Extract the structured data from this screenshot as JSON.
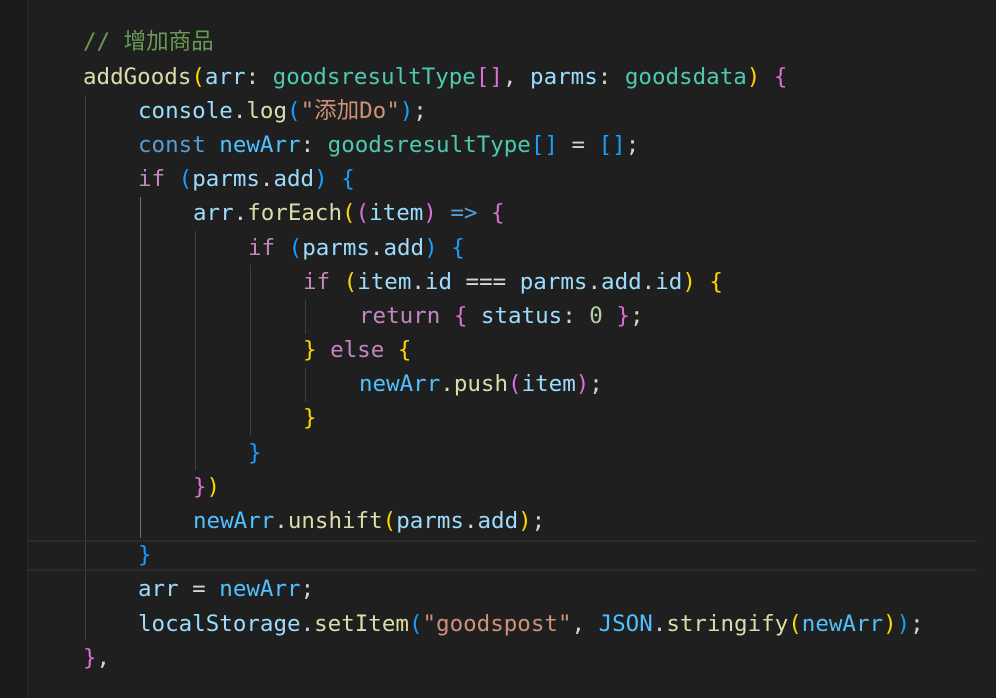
{
  "editor": {
    "theme": "dark",
    "colors": {
      "background": "#1f1f1f",
      "control_keyword": "#c586c0",
      "keyword": "#569cd6",
      "function": "#dcdcaa",
      "variable": "#9cdcfe",
      "constant": "#4fc1ff",
      "type": "#4ec9b0",
      "string": "#ce9178",
      "number": "#b5cea8",
      "comment": "#6a9955",
      "bracket_level1": "#ffd700",
      "bracket_level2": "#da70d6",
      "bracket_level3": "#179fff"
    },
    "code_lines": [
      "// 增加商品",
      "addGoods(arr: goodsresultType[], parms: goodsdata) {",
      "    console.log(\"添加Do\");",
      "    const newArr: goodsresultType[] = [];",
      "    if (parms.add) {",
      "        arr.forEach((item) => {",
      "            if (parms.add) {",
      "                if (item.id === parms.add.id) {",
      "                    return { status: 0 };",
      "                } else {",
      "                    newArr.push(item);",
      "                }",
      "            }",
      "        })",
      "        newArr.unshift(parms.add);",
      "    }",
      "    arr = newArr;",
      "    localStorage.setItem(\"goodspost\", JSON.stringify(newArr));",
      "},"
    ],
    "tokens": {
      "l1_comment": "// 增加商品",
      "l2_name": "addGoods",
      "l2_open": "(",
      "l2_p1": "arr",
      "l2_c1": ": ",
      "l2_t1": "goodsresultType",
      "l2_arr": "[]",
      "l2_comma": ", ",
      "l2_p2": "parms",
      "l2_c2": ": ",
      "l2_t2": "goodsdata",
      "l2_close": ")",
      "l2_sp": " ",
      "l2_brace": "{",
      "l3_obj": "console",
      "l3_dot": ".",
      "l3_fn": "log",
      "l3_open": "(",
      "l3_str": "\"添加Do\"",
      "l3_close": ")",
      "l3_semi": ";",
      "l4_kw": "const",
      "l4_sp": " ",
      "l4_var": "newArr",
      "l4_colon": ": ",
      "l4_type": "goodsresultType",
      "l4_arr": "[]",
      "l4_eq": " = ",
      "l4_lit": "[]",
      "l4_semi": ";",
      "l5_kw": "if",
      "l5_sp": " ",
      "l5_open": "(",
      "l5_obj": "parms",
      "l5_dot": ".",
      "l5_prop": "add",
      "l5_close": ")",
      "l5_sp2": " ",
      "l5_brace": "{",
      "l6_obj": "arr",
      "l6_dot": ".",
      "l6_fn": "forEach",
      "l6_open": "(",
      "l6_popen": "(",
      "l6_param": "item",
      "l6_pclose": ")",
      "l6_sp": " ",
      "l6_arrow": "=>",
      "l6_sp2": " ",
      "l6_brace": "{",
      "l7_kw": "if",
      "l7_sp": " ",
      "l7_open": "(",
      "l7_obj": "parms",
      "l7_dot": ".",
      "l7_prop": "add",
      "l7_close": ")",
      "l7_sp2": " ",
      "l7_brace": "{",
      "l8_kw": "if",
      "l8_sp": " ",
      "l8_open": "(",
      "l8_obj": "item",
      "l8_dot": ".",
      "l8_prop": "id",
      "l8_op": " === ",
      "l8_obj2": "parms",
      "l8_dot2": ".",
      "l8_prop2": "add",
      "l8_dot3": ".",
      "l8_prop3": "id",
      "l8_close": ")",
      "l8_sp2": " ",
      "l8_brace": "{",
      "l9_kw": "return",
      "l9_sp": " ",
      "l9_open": "{",
      "l9_key": " status",
      "l9_colon": ": ",
      "l9_num": "0",
      "l9_sp2": " ",
      "l9_close": "}",
      "l9_semi": ";",
      "l10_close": "}",
      "l10_sp": " ",
      "l10_kw": "else",
      "l10_sp2": " ",
      "l10_brace": "{",
      "l11_obj": "newArr",
      "l11_dot": ".",
      "l11_fn": "push",
      "l11_open": "(",
      "l11_arg": "item",
      "l11_close": ")",
      "l11_semi": ";",
      "l12_close": "}",
      "l13_close": "}",
      "l14_brace": "}",
      "l14_paren": ")",
      "l15_obj": "newArr",
      "l15_dot": ".",
      "l15_fn": "unshift",
      "l15_open": "(",
      "l15_arg": "parms",
      "l15_dot2": ".",
      "l15_prop": "add",
      "l15_close": ")",
      "l15_semi": ";",
      "l16_close": "}",
      "l17_var": "arr",
      "l17_eq": " = ",
      "l17_val": "newArr",
      "l17_semi": ";",
      "l18_obj": "localStorage",
      "l18_dot": ".",
      "l18_fn": "setItem",
      "l18_open": "(",
      "l18_str": "\"goodspost\"",
      "l18_comma": ", ",
      "l18_json": "JSON",
      "l18_dot2": ".",
      "l18_fn2": "stringify",
      "l18_open2": "(",
      "l18_arg": "newArr",
      "l18_close2": ")",
      "l18_close": ")",
      "l18_semi": ";",
      "l19_close": "}",
      "l19_comma": ","
    }
  }
}
